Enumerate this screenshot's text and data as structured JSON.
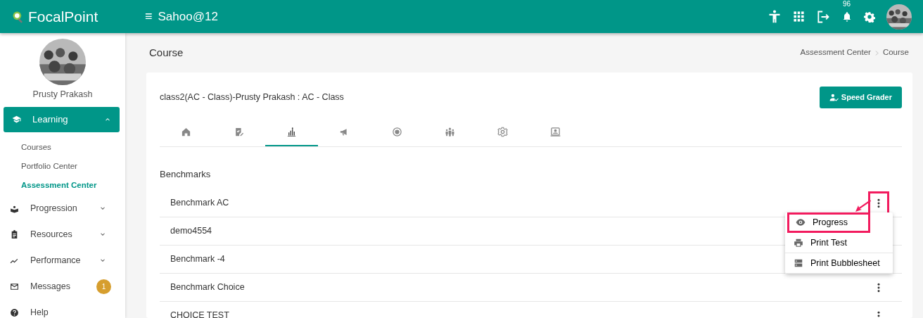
{
  "header": {
    "brand": "FocalPoint",
    "menu_glyph": "≡",
    "account": "Sahoo@12",
    "notification_count": "96"
  },
  "sidebar": {
    "user_name": "Prusty Prakash",
    "items": [
      {
        "label": "Learning",
        "expanded": true,
        "children": [
          {
            "label": "Courses",
            "selected": false
          },
          {
            "label": "Portfolio Center",
            "selected": false
          },
          {
            "label": "Assessment Center",
            "selected": true
          }
        ]
      },
      {
        "label": "Progression",
        "expanded": false
      },
      {
        "label": "Resources",
        "expanded": false
      },
      {
        "label": "Performance",
        "expanded": false
      },
      {
        "label": "Messages",
        "badge": "1"
      },
      {
        "label": "Help"
      }
    ]
  },
  "page": {
    "title": "Course",
    "breadcrumb": [
      "Assessment Center",
      "Course"
    ]
  },
  "course": {
    "title": "class2(AC - Class)-Prusty Prakash : AC - Class",
    "speed_grader": "Speed Grader",
    "tabs": [
      {
        "selected": false
      },
      {
        "selected": false
      },
      {
        "selected": true
      },
      {
        "selected": false
      },
      {
        "selected": false
      },
      {
        "selected": false
      },
      {
        "selected": false
      },
      {
        "selected": false
      }
    ],
    "section": "Benchmarks",
    "rows": [
      {
        "name": "Benchmark AC",
        "menu_open": true,
        "highlighted": true
      },
      {
        "name": "demo4554"
      },
      {
        "name": "Benchmark -4"
      },
      {
        "name": "Benchmark Choice"
      },
      {
        "name": "CHOICE TEST"
      }
    ],
    "row_menu": [
      {
        "label": "Progress",
        "highlighted": true
      },
      {
        "label": "Print Test",
        "highlighted": false
      },
      {
        "label": "Print Bubblesheet",
        "highlighted": false
      }
    ]
  }
}
